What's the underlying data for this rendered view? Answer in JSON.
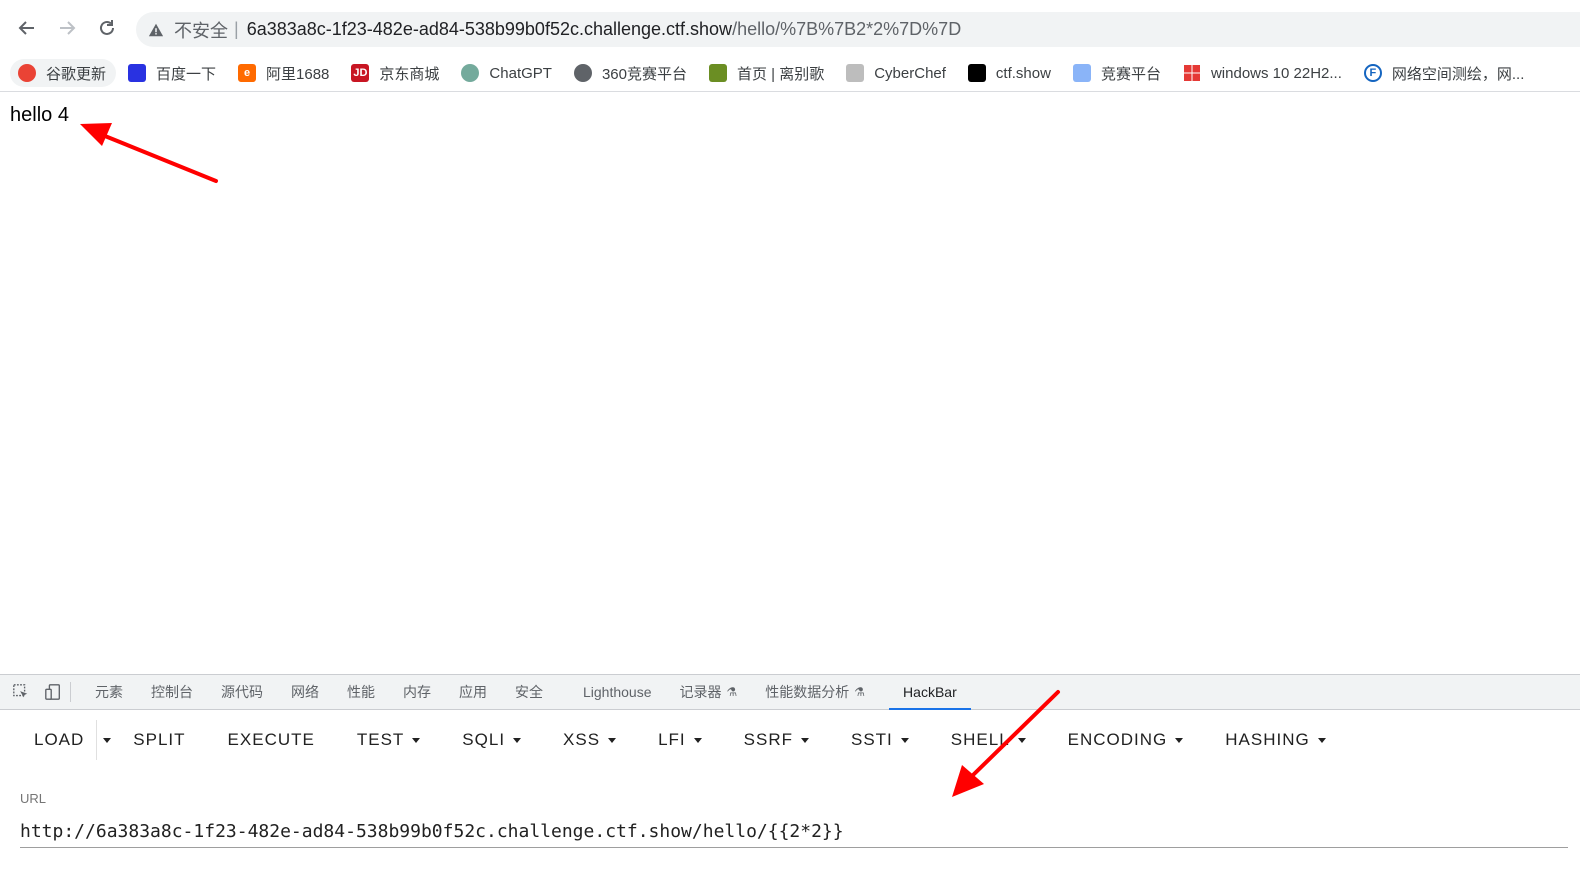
{
  "browser": {
    "url_security_label": "不安全",
    "url_separator": "|",
    "url_host": "6a383a8c-1f23-482e-ad84-538b99b0f52c.challenge.ctf.show",
    "url_path": "/hello/%7B%7B2*2%7D%7D"
  },
  "bookmarks": [
    {
      "label": "谷歌更新",
      "icon": "chrome-icon",
      "color": "#ea4335"
    },
    {
      "label": "百度一下",
      "icon": "baidu-paw-icon",
      "color": "#2932e1"
    },
    {
      "label": "阿里1688",
      "icon": "alibaba-1688-icon",
      "color": "#ff6a00"
    },
    {
      "label": "京东商城",
      "icon": "jd-icon",
      "color": "#c81623"
    },
    {
      "label": "ChatGPT",
      "icon": "chatgpt-icon",
      "color": "#74aa9c"
    },
    {
      "label": "360竞赛平台",
      "icon": "globe-icon",
      "color": "#5f6368"
    },
    {
      "label": "首页 | 离别歌",
      "icon": "plant-icon",
      "color": "#6b8e23"
    },
    {
      "label": "CyberChef",
      "icon": "chef-hat-icon",
      "color": "#bdbdbd"
    },
    {
      "label": "ctf.show",
      "icon": "ctfshow-icon",
      "color": "#000000"
    },
    {
      "label": "竞赛平台",
      "icon": "bird-icon",
      "color": "#8ab4f8"
    },
    {
      "label": "windows 10 22H2...",
      "icon": "windows-icon",
      "color": "#e53935"
    },
    {
      "label": "网络空间测绘，网...",
      "icon": "fofa-icon",
      "color": "#1565c0"
    }
  ],
  "page": {
    "output_text": "hello 4"
  },
  "devtools": {
    "tabs": [
      {
        "label": "元素",
        "active": false
      },
      {
        "label": "控制台",
        "active": false
      },
      {
        "label": "源代码",
        "active": false
      },
      {
        "label": "网络",
        "active": false
      },
      {
        "label": "性能",
        "active": false
      },
      {
        "label": "内存",
        "active": false
      },
      {
        "label": "应用",
        "active": false
      },
      {
        "label": "安全",
        "active": false
      },
      {
        "label": "Lighthouse",
        "active": false
      },
      {
        "label": "记录器",
        "active": false,
        "experimental": true
      },
      {
        "label": "性能数据分析",
        "active": false,
        "experimental": true
      },
      {
        "label": "HackBar",
        "active": true
      }
    ],
    "accent_color": "#1a73e8"
  },
  "hackbar": {
    "buttons": [
      {
        "label": "LOAD",
        "dropdown": false
      },
      {
        "label": "SPLIT",
        "dropdown": false
      },
      {
        "label": "EXECUTE",
        "dropdown": false
      },
      {
        "label": "TEST",
        "dropdown": true
      },
      {
        "label": "SQLI",
        "dropdown": true
      },
      {
        "label": "XSS",
        "dropdown": true
      },
      {
        "label": "LFI",
        "dropdown": true
      },
      {
        "label": "SSRF",
        "dropdown": true
      },
      {
        "label": "SSTI",
        "dropdown": true
      },
      {
        "label": "SHELL",
        "dropdown": true
      },
      {
        "label": "ENCODING",
        "dropdown": true
      },
      {
        "label": "HASHING",
        "dropdown": true
      }
    ],
    "url_label": "URL",
    "url_value": "http://6a383a8c-1f23-482e-ad84-538b99b0f52c.challenge.ctf.show/hello/{{2*2}}"
  },
  "annotation_color": "#ff0000"
}
